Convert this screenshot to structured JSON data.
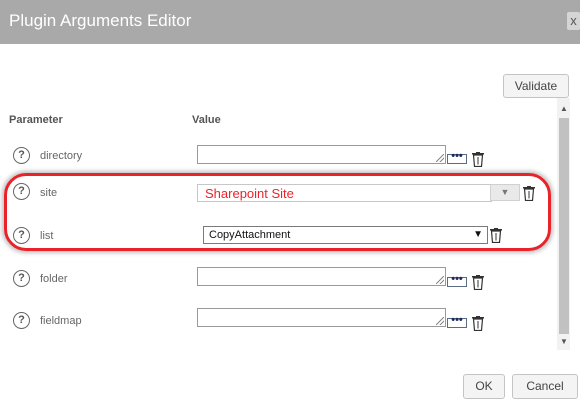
{
  "dialog": {
    "title": "Plugin Arguments Editor",
    "close_label": "x"
  },
  "toolbar": {
    "validate_label": "Validate"
  },
  "table": {
    "header_parameter": "Parameter",
    "header_value": "Value",
    "rows": [
      {
        "name": "directory",
        "value": ""
      },
      {
        "name": "site",
        "value": "Sharepoint Site"
      },
      {
        "name": "list",
        "value": "CopyAttachment"
      },
      {
        "name": "folder",
        "value": ""
      },
      {
        "name": "fieldmap",
        "value": ""
      }
    ]
  },
  "help_glyph": "?",
  "more_glyph": "•••",
  "footer": {
    "ok_label": "OK",
    "cancel_label": "Cancel"
  },
  "colors": {
    "highlight": "#e8242a",
    "titlebar": "#a9a9a9"
  },
  "icons": [
    "close-icon",
    "help-icon",
    "more-options-icon",
    "trash-icon",
    "dropdown-arrow-icon",
    "resize-grip-icon"
  ]
}
